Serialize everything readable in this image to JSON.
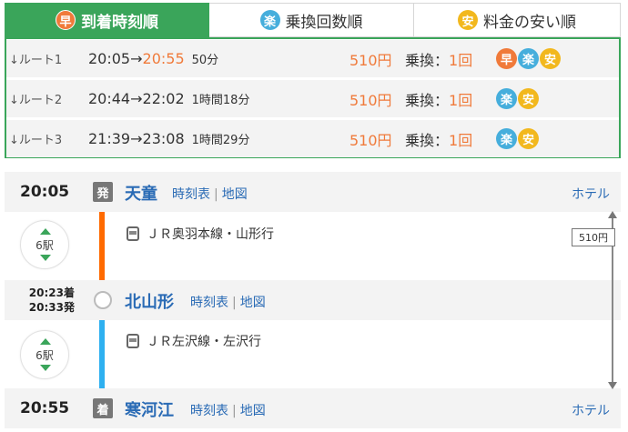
{
  "tabs": [
    {
      "badge": "早",
      "label": "到着時刻順",
      "active": true
    },
    {
      "badge": "楽",
      "label": "乗換回数順",
      "active": false
    },
    {
      "badge": "安",
      "label": "料金の安い順",
      "active": false
    }
  ],
  "routes": [
    {
      "label": "↓ルート1",
      "dep": "20:05",
      "arrow": "→",
      "arr": "20:55",
      "duration": "50分",
      "fare": "510円",
      "transfer_label": "乗換：",
      "transfer_count": "1回",
      "badges": [
        "早",
        "楽",
        "安"
      ]
    },
    {
      "label": "↓ルート2",
      "dep": "20:44",
      "arrow": "→",
      "arr": "22:02",
      "duration": "1時間18分",
      "fare": "510円",
      "transfer_label": "乗換：",
      "transfer_count": "1回",
      "badges": [
        "楽",
        "安"
      ]
    },
    {
      "label": "↓ルート3",
      "dep": "21:39",
      "arrow": "→",
      "arr": "23:08",
      "duration": "1時間29分",
      "fare": "510円",
      "transfer_label": "乗換：",
      "transfer_count": "1回",
      "badges": [
        "楽",
        "安"
      ]
    }
  ],
  "detail": {
    "stations": [
      {
        "time": "20:05",
        "mark": "発",
        "name": "天童",
        "timetable": "時刻表",
        "map": "地図",
        "hotel": "ホテル"
      },
      {
        "time_arr": "20:23着",
        "time_dep": "20:33発",
        "name": "北山形",
        "timetable": "時刻表",
        "map": "地図"
      },
      {
        "time": "20:55",
        "mark": "着",
        "name": "寒河江",
        "timetable": "時刻表",
        "map": "地図",
        "hotel": "ホテル"
      }
    ],
    "segments": [
      {
        "line": "ＪＲ奥羽本線・山形行",
        "stops": "6駅",
        "color": "#ff6a00"
      },
      {
        "line": "ＪＲ左沢線・左沢行",
        "stops": "6駅",
        "color": "#2eb0f0"
      }
    ],
    "fare": "510円"
  },
  "colors": {
    "green": "#3aa55a",
    "orange": "#f07a3a",
    "link": "#2a6bb5"
  }
}
